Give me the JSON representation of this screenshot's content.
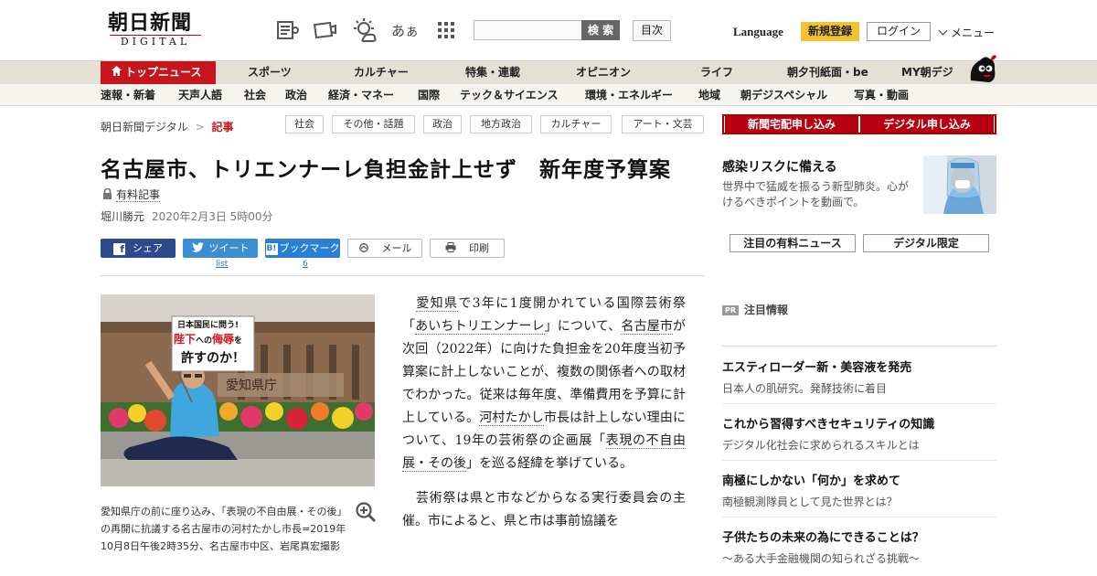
{
  "header": {
    "logo_jp": "朝日新聞",
    "logo_en": "DIGITAL",
    "search_button": "検 索",
    "toc_button": "目次",
    "language": "Language",
    "register": "新規登録",
    "login": "ログイン",
    "menu": "メニュー",
    "font_size_icon_text": "あぁ",
    "accent_color": "#c4161c"
  },
  "nav_main": {
    "top_news": "トップニュース",
    "items": [
      "スポーツ",
      "カルチャー",
      "特集・連載",
      "オピニオン",
      "ライフ",
      "朝夕刊紙面・be",
      "MY朝デジ"
    ]
  },
  "nav_sub": {
    "items": [
      "速報・新着",
      "天声人語",
      "社会",
      "政治",
      "経済・マネー",
      "国際",
      "テック＆サイエンス",
      "環境・エネルギー",
      "地域",
      "朝デジスペシャル",
      "写真・動画"
    ]
  },
  "breadcrumb": {
    "home": "朝日新聞デジタル",
    "separator": ">",
    "current": "記事"
  },
  "tags": [
    "社会",
    "その他・話題",
    "政治",
    "地方政治",
    "カルチャー",
    "アート・文芸"
  ],
  "article": {
    "title": "名古屋市、トリエンナーレ負担金計上せず　新年度予算案",
    "paid_label": "有料記事",
    "author": "堀川勝元",
    "date": "2020年2月3日 5時00分",
    "photo_sign": {
      "l1": "日本国民に問う!",
      "l2a": "陛下",
      "l2b": "への",
      "l2c": "侮辱",
      "l2d": "を",
      "l3": "許すのか！"
    },
    "photo_building_text": "愛知県庁",
    "caption": "愛知県庁の前に座り込み、「表現の不自由展・その後」の再開に抗議する名古屋市の河村たかし市長=2019年10月8日午後2時35分、名古屋市中区、岩尾真宏撮影",
    "p1": {
      "l1": "愛知県",
      "t1": "で3年に1度開かれている国際芸術祭「",
      "l2": "あいちトリエンナーレ",
      "t2": "」について、",
      "l3": "名古屋市",
      "t3": "が次回（2022年）に向けた負担金を20年度当初予算案に計上しないことが、複数の関係者への取材でわかった。従来は毎年度、準備費用を予算に計上している。",
      "l4": "河村たかし",
      "t4": "市長は計上しない理由について、19年の芸術祭の企画展「",
      "l5": "表現の不自由展・その後",
      "t5": "」を巡る経緯を挙げている。"
    },
    "p2": "芸術祭は県と市などからなる実行委員会の主催。市によると、県と市は事前協議を"
  },
  "share": {
    "facebook": "シェア",
    "twitter": "ツイート",
    "twitter_sub": "list",
    "hatena": "ブックマーク",
    "hatena_sub": "6",
    "mail": "メール",
    "print": "印刷"
  },
  "sidebar": {
    "subscribe_paper": "新聞宅配申し込み",
    "subscribe_digital": "デジタル申し込み",
    "covid_title": "感染リスクに備える",
    "covid_text": "世界中で猛威を振るう新型肺炎。心がけるべきポイントを動画で。",
    "tab_paid": "注目の有料ニュース",
    "tab_digital": "デジタル限定",
    "pr_badge": "PR",
    "pr_title": "注目情報",
    "pr_items": [
      {
        "headline": "エスティローダー新・美容液を発売",
        "desc": "日本人の肌研究。発酵技術に着目"
      },
      {
        "headline": "これから習得すべきセキュリティの知識",
        "desc": "デジタル化社会に求められるスキルとは"
      },
      {
        "headline": "南極にしかない「何か」を求めて",
        "desc": "南極観測隊員として見た世界とは？"
      },
      {
        "headline": "子供たちの未来の為にできることは？",
        "desc": "～ある大手金融機関の知られざる挑戦～"
      }
    ]
  }
}
